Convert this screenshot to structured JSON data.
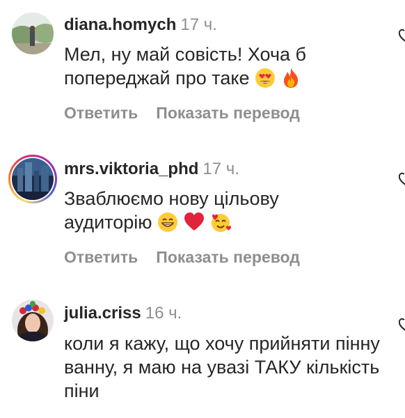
{
  "comments": [
    {
      "username": "diana.homych",
      "time": "17 ч.",
      "text": "Мел, ну май совість! Хоча б попереджай про таке",
      "emojis": [
        "heart-eyes-emoji",
        "fire-emoji"
      ],
      "reply_label": "Ответить",
      "translate_label": "Показать перевод",
      "has_story_ring": false
    },
    {
      "username": "mrs.viktoria_phd",
      "time": "17 ч.",
      "text_line1": "Зваблюємо нову цільову",
      "text_line2": "аудиторію",
      "emojis": [
        "grin-emoji",
        "red-heart-emoji",
        "smiling-face-with-hearts-emoji"
      ],
      "reply_label": "Ответить",
      "translate_label": "Показать перевод",
      "has_story_ring": true
    },
    {
      "username": "julia.criss",
      "time": "16 ч.",
      "text": "коли я кажу, що хочу прийняти пінну ванну, я маю на увазі ТАКУ кількість піни",
      "has_story_ring": false
    }
  ],
  "colors": {
    "text": "#262626",
    "secondary": "#8e8e8e",
    "background": "#ffffff"
  }
}
